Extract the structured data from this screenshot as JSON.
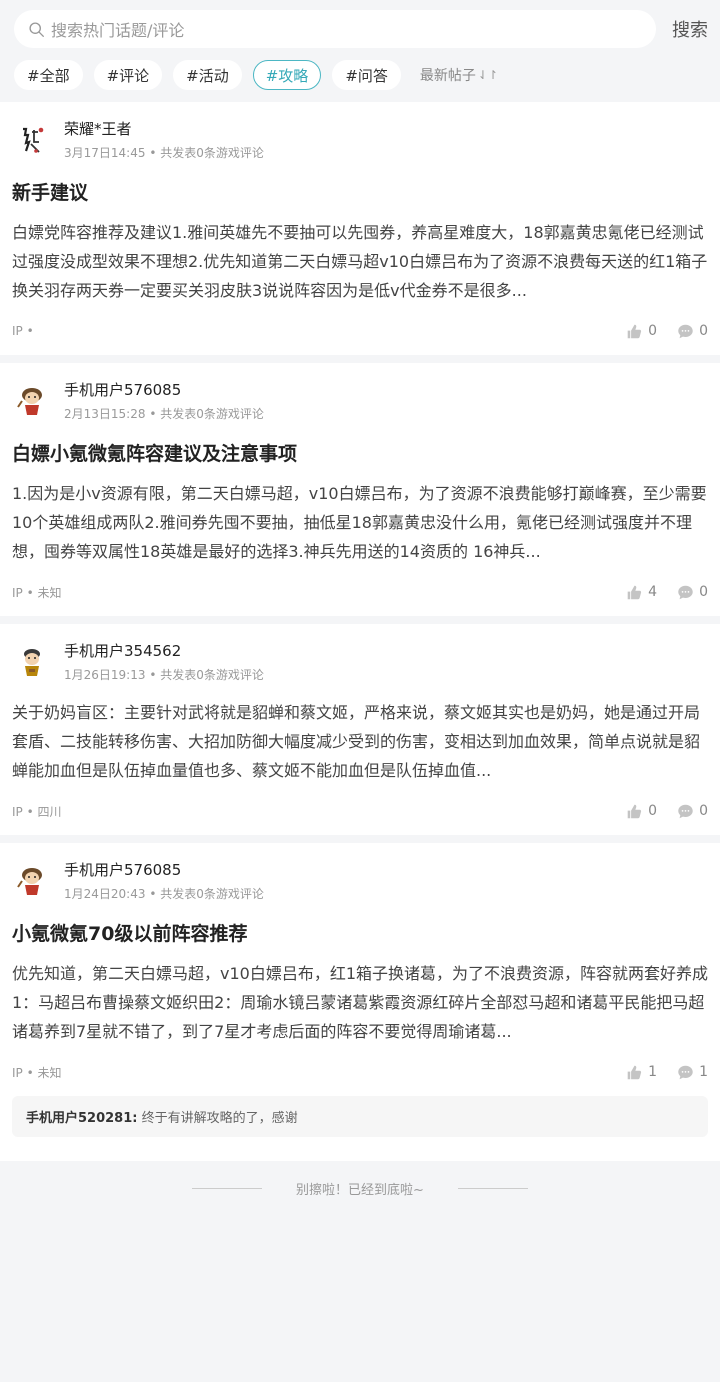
{
  "search": {
    "placeholder": "搜索热门话题/评论",
    "button": "搜索"
  },
  "tabs": [
    {
      "label": "#全部"
    },
    {
      "label": "#评论"
    },
    {
      "label": "#活动"
    },
    {
      "label": "#攻略",
      "active": true
    },
    {
      "label": "#问答"
    }
  ],
  "sort_label": "最新帖子",
  "sort_icon": "⇃↾",
  "posts": [
    {
      "user": "荣耀*王者",
      "time": "3月17日14:45",
      "sep": "•",
      "info": "共发表0条游戏评论",
      "title": "新手建议",
      "body": "白嫖党阵容推荐及建议1.雅间英雄先不要抽可以先囤券，养高星难度大，18郭嘉黄忠氪佬已经测试过强度没成型效果不理想2.优先知道第二天白嫖马超v10白嫖吕布为了资源不浪费每天送的红1箱子换关羽存两天券一定要买关羽皮肤3说说阵容因为是低v代金券不是很多...",
      "ip": "IP •",
      "likes": "0",
      "comments": "0"
    },
    {
      "user": "手机用户576085",
      "time": "2月13日15:28",
      "sep": "•",
      "info": "共发表0条游戏评论",
      "title": "白嫖小氪微氪阵容建议及注意事项",
      "body": "1.因为是小v资源有限，第二天白嫖马超，v10白嫖吕布，为了资源不浪费能够打巅峰赛，至少需要10个英雄组成两队2.雅间券先囤不要抽，抽低星18郭嘉黄忠没什么用，氪佬已经测试强度并不理想，囤券等双属性18英雄是最好的选择3.神兵先用送的14资质的 16神兵...",
      "ip": "IP • 未知",
      "likes": "4",
      "comments": "0"
    },
    {
      "user": "手机用户354562",
      "time": "1月26日19:13",
      "sep": "•",
      "info": "共发表0条游戏评论",
      "title": "",
      "body": "关于奶妈盲区：主要针对武将就是貂蝉和蔡文姬，严格来说，蔡文姬其实也是奶妈，她是通过开局套盾、二技能转移伤害、大招加防御大幅度减少受到的伤害，变相达到加血效果，简单点说就是貂蝉能加血但是队伍掉血量值也多、蔡文姬不能加血但是队伍掉血值...",
      "ip": "IP • 四川",
      "likes": "0",
      "comments": "0"
    },
    {
      "user": "手机用户576085",
      "time": "1月24日20:43",
      "sep": "•",
      "info": "共发表0条游戏评论",
      "title": "小氪微氪70级以前阵容推荐",
      "body": "优先知道，第二天白嫖马超，v10白嫖吕布，红1箱子换诸葛，为了不浪费资源，阵容就两套好养成1：马超吕布曹操蔡文姬织田2：周瑜水镜吕蒙诸葛紫霞资源红碎片全部怼马超和诸葛平民能把马超诸葛养到7星就不错了，到了7星才考虑后面的阵容不要觉得周瑜诸葛...",
      "ip": "IP • 未知",
      "likes": "1",
      "comments": "1",
      "reply_user": "手机用户520281:",
      "reply_text": "终于有讲解攻略的了，感谢"
    }
  ],
  "end_text": "别擦啦！已经到底啦~",
  "colors": {
    "accent": "#4cb7c4",
    "background": "#f4f5f7"
  },
  "icons": {
    "search": "search-icon",
    "like": "thumbs-up-icon",
    "comment": "comment-bubble-icon"
  }
}
